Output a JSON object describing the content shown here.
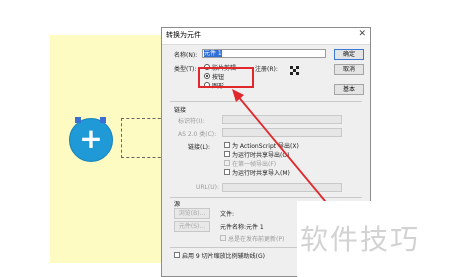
{
  "dialog": {
    "title": "转换为元件",
    "close_glyph": "✕",
    "name_label": "名称(N):",
    "name_value": "元件 1",
    "type_label": "类型(T):",
    "type_options": [
      "影片剪辑",
      "按钮",
      "图形"
    ],
    "selected_type": "按钮",
    "registration_label": "注册(R):",
    "ok_label": "确定",
    "cancel_label": "取消",
    "basic_label": "基本",
    "linkage": {
      "section_label": "链接",
      "identifier_label": "标识符(I):",
      "as2_label": "AS 2.0 类(C):",
      "linkage_label": "链接(L):",
      "export_as": "为 ActionScript 导出(X)",
      "export_share": "为运行时共享导出(O)",
      "export_first_frame": "在第一帧导出(F)",
      "import_share": "为运行时共享导入(M)",
      "url_label": "URL(U):"
    },
    "source": {
      "section_label": "源",
      "browse_label": "浏览(B)...",
      "file_label": "文件:",
      "symbol_button_label": "元件(S)...",
      "symbol_name_label": "元件名称:元件 1",
      "always_update_label": "总是在发布前更新(P)"
    },
    "scale9_label": "启用 9 切片缩放比例辅助线(G)"
  },
  "stage": {
    "button_glyph": "+"
  },
  "watermark": "软件技巧",
  "colors": {
    "highlight": "#e0282c",
    "stage": "#fdfbc2",
    "button": "#1f9ad6"
  }
}
